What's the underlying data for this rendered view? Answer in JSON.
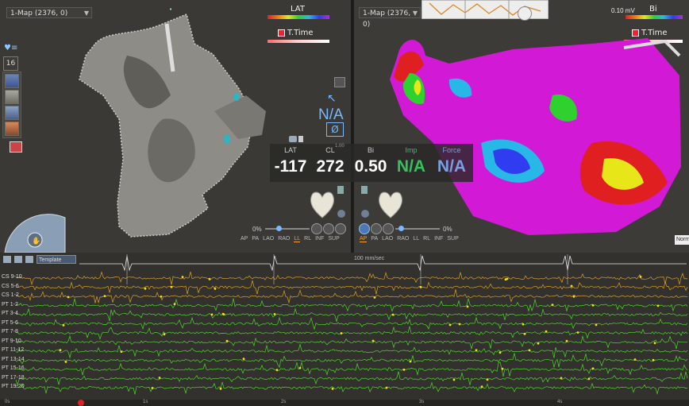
{
  "left_map": {
    "selector": "1-Map (2376, 0)",
    "lat_label": "LAT",
    "ttime_label": "T.Time"
  },
  "right_map": {
    "selector": "1-Map (2376, 0)",
    "scale_value": "0.10 mV",
    "bi_label": "Bi",
    "ttime_label": "T.Time",
    "status": "Norm"
  },
  "toolbox": {
    "point_count": "16"
  },
  "center_tools": {
    "na_label": "N/A",
    "pin_label": "Ø"
  },
  "readout": {
    "lat": {
      "label": "LAT",
      "value": "-117"
    },
    "cl": {
      "label": "CL",
      "value": "272"
    },
    "bi": {
      "label": "Bi",
      "value": "0.50"
    },
    "imp": {
      "label": "Imp",
      "value": "N/A"
    },
    "force": {
      "label": "Force",
      "value": "N/A"
    },
    "scale_small": "1.00"
  },
  "view_controls_left": {
    "opacity": "0%",
    "views": [
      "AP",
      "PA",
      "LAO",
      "RAO",
      "LL",
      "RL",
      "INF",
      "SUP"
    ],
    "active": "LL"
  },
  "view_controls_right": {
    "opacity": "0%",
    "views": [
      "AP",
      "PA",
      "LAO",
      "RAO",
      "LL",
      "RL",
      "INF",
      "SUP"
    ],
    "active": "AP"
  },
  "ecg": {
    "template_label": "Template",
    "sweep_label": "100 mm/sec",
    "channels": [
      "CS 9-10",
      "CS 5-6",
      "CS 1-2",
      "PT 1-2",
      "PT 3-4",
      "PT 5-6",
      "PT 7-8",
      "PT 9-10",
      "PT 11-12",
      "PT 13-14",
      "PT 15-16",
      "PT 17-18",
      "PT 19-20"
    ],
    "time_ticks": [
      "0s",
      "1s",
      "2s",
      "3s",
      "4s"
    ]
  },
  "colors": {
    "cs": "#e0a020",
    "pt": "#4ed82a",
    "magenta": "#d21ad6",
    "lat_value": "#ffffff",
    "imp_value": "#36c25a",
    "force_value": "#7a9fe0"
  }
}
